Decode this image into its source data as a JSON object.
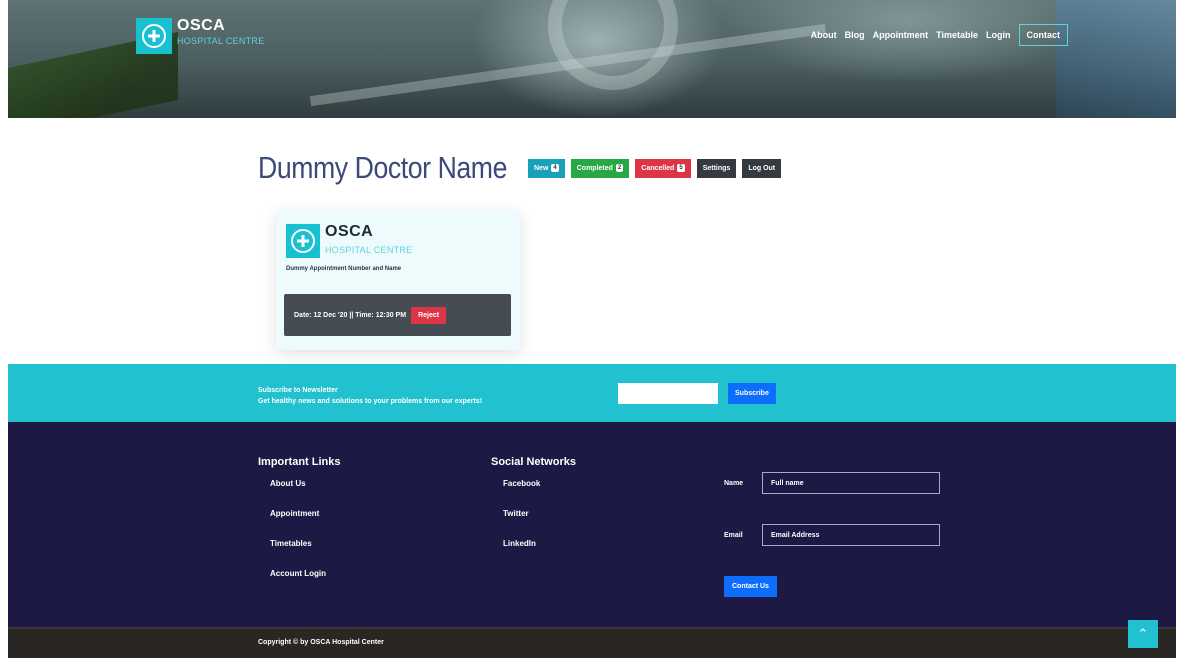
{
  "brand": {
    "name": "OSCA",
    "subtitle": "HOSPITAL CENTRE"
  },
  "nav": {
    "items": [
      "About",
      "Blog",
      "Appointment",
      "Timetable",
      "Login"
    ],
    "contact": "Contact"
  },
  "doctor": {
    "name": "Dummy Doctor Name",
    "buttons": {
      "new": "New",
      "new_count": "4",
      "completed": "Completed",
      "completed_count": "2",
      "cancelled": "Cancelled",
      "cancelled_count": "5",
      "settings": "Settings",
      "logout": "Log Out"
    }
  },
  "card": {
    "appointment": "Dummy Appointment Number and Name",
    "datetime": "Date: 12 Dec '20 || Time: 12:30 PM",
    "reject": "Reject"
  },
  "newsletter": {
    "title": "Subscribe to Newsletter",
    "subtitle": "Get healthy news and solutions to your problems from our experts!",
    "button": "Subscribe"
  },
  "footer": {
    "links_title": "Important Links",
    "links": [
      "About Us",
      "Appointment",
      "Timetables",
      "Account Login"
    ],
    "social_title": "Social Networks",
    "social": [
      "Facebook",
      "Twitter",
      "LinkedIn"
    ],
    "name_label": "Name",
    "name_value": "Full name",
    "email_label": "Email",
    "email_value": "Email Address",
    "contact_button": "Contact Us"
  },
  "copyright": "Copyright © by OSCA Hospital Center",
  "colors": {
    "accent": "#22c1cf",
    "footer": "#1c1a45",
    "primary": "#0d6efd",
    "danger": "#dc3545",
    "success": "#28a745",
    "info": "#17a2b8",
    "dark": "#343a40"
  },
  "icons": [
    "medical-cross-icon",
    "chevron-up-icon"
  ]
}
